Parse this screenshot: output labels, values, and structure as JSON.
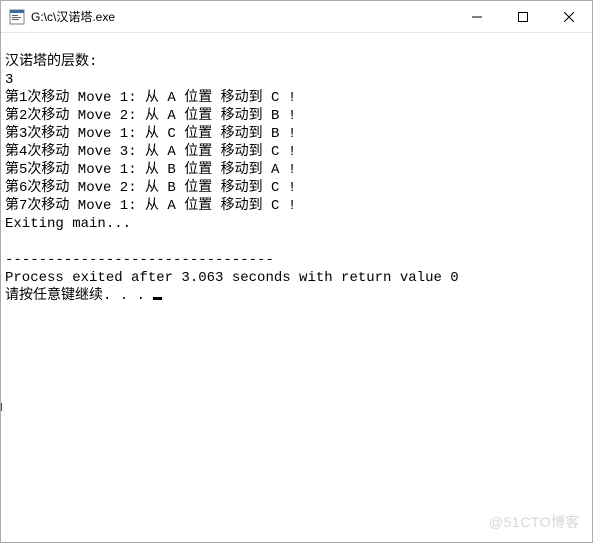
{
  "titlebar": {
    "icon": "app-icon",
    "path": "G:\\c\\汉诺塔.exe"
  },
  "controls": {
    "minimize": "–",
    "maximize": "▢",
    "close": "✕"
  },
  "console": {
    "prompt_levels": "汉诺塔的层数:",
    "input_value": "3",
    "moves": [
      "第1次移动 Move 1: 从 A 位置 移动到 C !",
      "第2次移动 Move 2: 从 A 位置 移动到 B !",
      "第3次移动 Move 1: 从 C 位置 移动到 B !",
      "第4次移动 Move 3: 从 A 位置 移动到 C !",
      "第5次移动 Move 1: 从 B 位置 移动到 A !",
      "第6次移动 Move 2: 从 B 位置 移动到 C !",
      "第7次移动 Move 1: 从 A 位置 移动到 C !"
    ],
    "exit_line": "Exiting main...",
    "blank": "",
    "separator": "--------------------------------",
    "process_line": "Process exited after 3.063 seconds with return value 0",
    "continue_line": "请按任意键继续. . . "
  },
  "watermark": "@51CTO博客"
}
